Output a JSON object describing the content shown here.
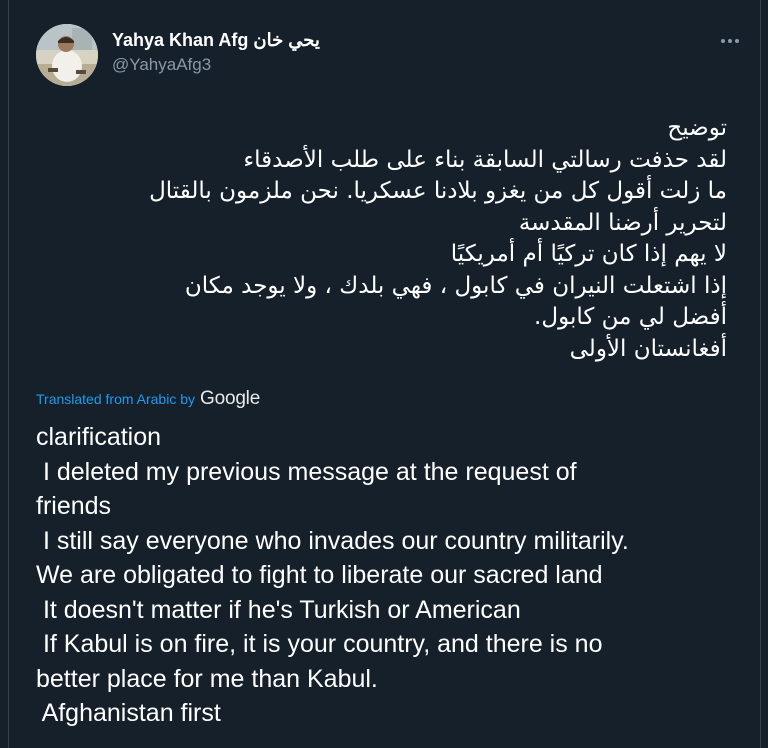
{
  "author": {
    "display_name": "Yahya Khan Afg يحي خان",
    "handle": "@YahyaAfg3"
  },
  "menu": {
    "more_icon": "more-horizontal-icon"
  },
  "tweet": {
    "arabic_lines": [
      "توضيح",
      "لقد حذفت رسالتي السابقة بناء على طلب الأصدقاء",
      "ما زلت أقول كل من يغزو بلادنا عسكريا. نحن ملزمون بالقتال",
      "لتحرير أرضنا المقدسة",
      "لا يهم إذا كان تركيًا أم أمريكيًا",
      "إذا اشتعلت النيران في كابول ، فهي بلدك ، ولا يوجد مكان",
      "أفضل لي من كابول.",
      "أفغانستان الأولى"
    ],
    "translation_label": "Translated from Arabic by",
    "translation_provider": "Google",
    "english_lines": [
      "clarification",
      " I deleted my previous message at the request of",
      "friends",
      " I still say everyone who invades our country militarily.",
      "We are obligated to fight to liberate our sacred land",
      " It doesn't matter if he's Turkish or American",
      " If Kabul is on fire, it is your country, and there is no",
      "better place for me than Kabul.",
      " Afghanistan first"
    ]
  }
}
